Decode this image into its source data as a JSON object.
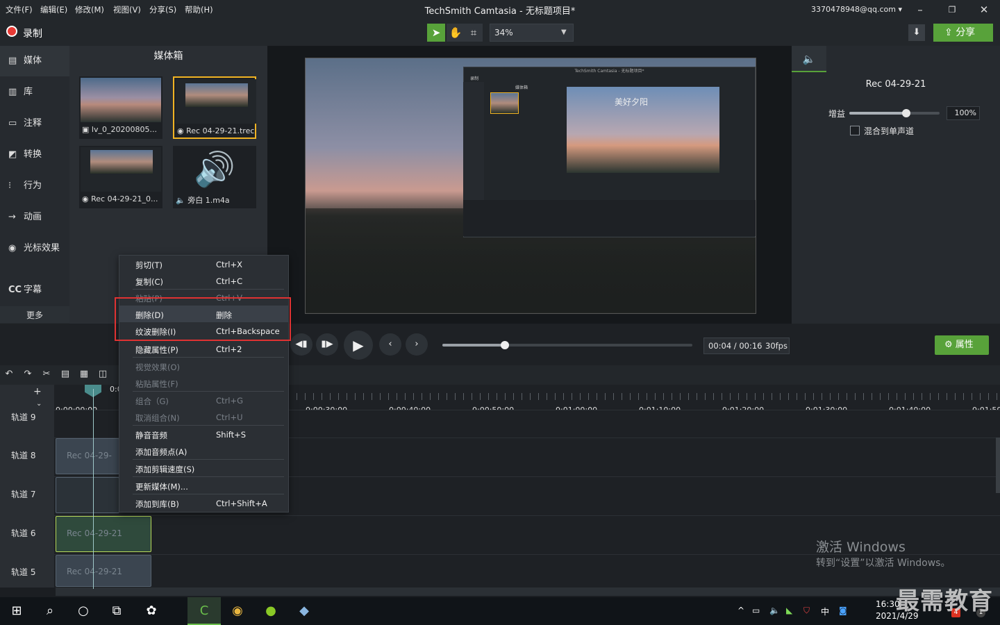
{
  "titlebar": {
    "menus": [
      "文件(F)",
      "编辑(E)",
      "修改(M)",
      "视图(V)",
      "分享(S)",
      "帮助(H)"
    ],
    "title": "TechSmith Camtasia - 无标题项目*",
    "account": "3370478948@qq.com"
  },
  "toolbar": {
    "record": "录制",
    "zoom": "34%",
    "share": "分享"
  },
  "sidebar": {
    "items": [
      "媒体",
      "库",
      "注释",
      "转换",
      "行为",
      "动画",
      "光标效果",
      "字幕"
    ],
    "more": "更多"
  },
  "bin": {
    "title": "媒体箱",
    "items": [
      "lv_0_20200805...",
      "Rec 04-29-21.trec",
      "Rec 04-29-21_0...",
      "旁白 1.m4a"
    ]
  },
  "canvas": {
    "inner_caption": "美好夕阳",
    "inner_title": "TechSmith Camtasia - 无标题项目*",
    "inner_record": "录制",
    "inner_bin": "媒体箱"
  },
  "props": {
    "title": "Rec 04-29-21",
    "gain_label": "增益",
    "gain_value": "100%",
    "gain_level": 0.63,
    "mono_label": "混合到单声道"
  },
  "playback": {
    "time": "00:04 / 00:16",
    "fps": "30fps",
    "attr": "属性",
    "progress": 0.25
  },
  "timeline": {
    "ruler": [
      "0:00:00;00",
      "0:00:30;00",
      "0:00:40;00",
      "0:00:50;00",
      "0:01:00;00",
      "0:01:10;00",
      "0:01:20;00",
      "0:01:30;00",
      "0:01:40;00",
      "0:01:50;"
    ],
    "playhead_time": "0:0",
    "tracks": [
      "轨道 9",
      "轨道 8",
      "轨道 7",
      "轨道 6",
      "轨道 5"
    ],
    "clips": [
      "Rec 04-29-",
      "Rec 04-29-21",
      "Rec 04-29-21"
    ]
  },
  "context_menu": {
    "items": [
      {
        "label": "剪切(T)",
        "key": "Ctrl+X",
        "enabled": true
      },
      {
        "label": "复制(C)",
        "key": "Ctrl+C",
        "enabled": true
      },
      {
        "label": "粘贴(P)",
        "key": "Ctrl+V",
        "enabled": false
      },
      {
        "label": "删除(D)",
        "key": "删除",
        "enabled": true
      },
      {
        "label": "纹波删除(I)",
        "key": "Ctrl+Backspace",
        "enabled": true
      },
      {
        "label": "隐藏属性(P)",
        "key": "Ctrl+2",
        "enabled": true
      },
      {
        "label": "视觉效果(O)",
        "key": "",
        "enabled": false
      },
      {
        "label": "粘贴属性(F)",
        "key": "",
        "enabled": false
      },
      {
        "label": "组合（G)",
        "key": "Ctrl+G",
        "enabled": false
      },
      {
        "label": "取消组合(N)",
        "key": "Ctrl+U",
        "enabled": false
      },
      {
        "label": "静音音频",
        "key": "Shift+S",
        "enabled": true
      },
      {
        "label": "添加音频点(A)",
        "key": "",
        "enabled": true
      },
      {
        "label": "添加剪辑速度(S)",
        "key": "",
        "enabled": true
      },
      {
        "label": "更新媒体(M)...",
        "key": "",
        "enabled": true
      },
      {
        "label": "添加到库(B)",
        "key": "Ctrl+Shift+A",
        "enabled": true
      }
    ]
  },
  "watermark": {
    "line1": "激活 Windows",
    "line2": "转到“设置”以激活 Windows。",
    "brand": "最需教育"
  },
  "taskbar": {
    "time": "16:30",
    "date": "2021/4/29",
    "ime": "中",
    "badge1": "4",
    "badge2": "1"
  }
}
